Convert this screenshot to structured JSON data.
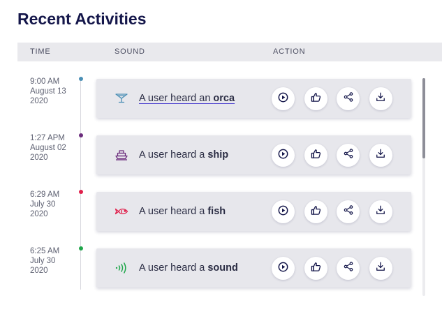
{
  "page": {
    "title": "Recent Activities"
  },
  "table": {
    "columns": {
      "time": "TIME",
      "sound": "SOUND",
      "action": "ACTION"
    }
  },
  "activities": [
    {
      "time": "9:00 AM",
      "date": "August 13",
      "year": "2020",
      "dot_color": "#4b8fb5",
      "icon": "glass-icon",
      "icon_color": "#4b8fb5",
      "prefix": "A user heard an ",
      "subject": "orca"
    },
    {
      "time": "1:27 APM",
      "date": "August 02",
      "year": "2020",
      "dot_color": "#6b2c7c",
      "icon": "ship-icon",
      "icon_color": "#6b2c7c",
      "prefix": "A user heard a ",
      "subject": "ship"
    },
    {
      "time": "6:29 AM",
      "date": "July 30",
      "year": "2020",
      "dot_color": "#e0204b",
      "icon": "fish-icon",
      "icon_color": "#e0204b",
      "prefix": "A user heard a ",
      "subject": "fish"
    },
    {
      "time": "6:25 AM",
      "date": "July 30",
      "year": "2020",
      "dot_color": "#1fa64a",
      "icon": "sound-waves-icon",
      "icon_color": "#1fa64a",
      "prefix": "A user heard a ",
      "subject": "sound"
    }
  ],
  "action_icons": [
    "play-icon",
    "thumbs-up-icon",
    "share-icon",
    "download-icon"
  ],
  "colors": {
    "title": "#14164a",
    "action_icon": "#14164a",
    "header_bg": "#e9e9ed",
    "card_bg": "#e7e7ec"
  },
  "scroll": {
    "thumb_fraction": 0.37
  }
}
